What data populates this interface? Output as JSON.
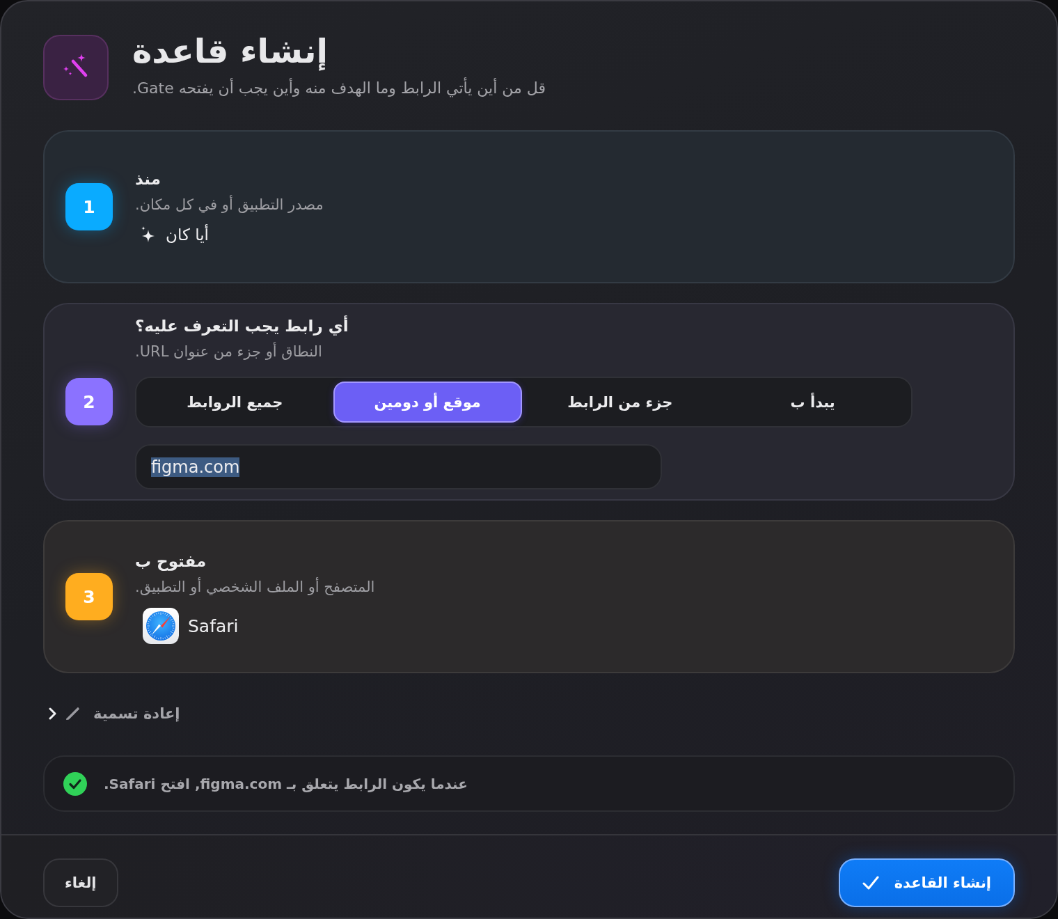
{
  "header": {
    "title": "إنشاء قاعدة",
    "subtitle": "قل من أين يأتي الرابط وما الهدف منه وأين يجب أن يفتحه Gate."
  },
  "steps": [
    {
      "kind": "source",
      "number": "1",
      "color": "#0aabff",
      "title": "منذ",
      "subtitle": "مصدر التطبيق أو في كل مكان.",
      "value": "أيا كان"
    },
    {
      "kind": "match",
      "number": "2",
      "color": "#8b72ff",
      "title": "أي رابط يجب التعرف عليه؟",
      "subtitle": "النطاق أو جزء من عنوان URL.",
      "segments": [
        {
          "label": "يبدأ ب",
          "selected": false
        },
        {
          "label": "جزء من الرابط",
          "selected": false
        },
        {
          "label": "موقع أو دومين",
          "selected": true
        },
        {
          "label": "جميع الروابط",
          "selected": false
        }
      ],
      "field": {
        "value": "figma.com",
        "text_selected": true
      }
    },
    {
      "kind": "app",
      "number": "3",
      "color": "#ffad1f",
      "title": "مفتوح ب",
      "subtitle": "المتصفح أو الملف الشخصي أو التطبيق.",
      "app": "Safari"
    }
  ],
  "rename": {
    "label": "إعادة تسمية",
    "expanded": false
  },
  "summary": {
    "text": "عندما يكون الرابط يتعلق بـ figma.com, افتح Safari.",
    "valid": true
  },
  "footer": {
    "buttons": [
      {
        "kind": "primary",
        "label": "إنشاء القاعدة"
      },
      {
        "kind": "secondary",
        "label": "إلغاء"
      }
    ]
  }
}
